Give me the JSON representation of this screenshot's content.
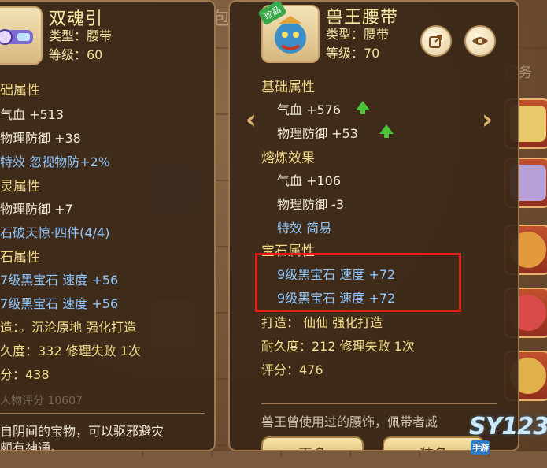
{
  "left_item": {
    "name": "双魂引",
    "type_line": "类型：腰带",
    "level_line": "等级：60",
    "sections": [
      {
        "title": "础属性"
      },
      {
        "title": "灵属性"
      },
      {
        "title": "石属性"
      }
    ],
    "base_lines": [
      "气血 +513",
      "物理防御 +38",
      "特效 忽视物防+2%"
    ],
    "spirit_lines": [
      "物理防御 +7",
      "石破天惊·四件(4/4)"
    ],
    "gem_lines": [
      "7级黑宝石  速度 +56",
      "7级黑宝石  速度 +56"
    ],
    "craft_line": "造：。沉沦原地   强化打造",
    "durability_line": "久度：332 修理失败 1次",
    "score_line": "分：438",
    "faded_line": "人物评分 10607",
    "desc_line1": "自阴间的宝物，可以驱邪避灾",
    "desc_line2": "颇有神通。"
  },
  "right_item": {
    "badge": "珍品",
    "name": "兽王腰带",
    "type_line": "类型：腰带",
    "level_line": "等级：70",
    "base_title": "基础属性",
    "base_lines": [
      "气血 +576",
      "物理防御 +53"
    ],
    "refine_title": "熔炼效果",
    "refine_lines": [
      "气血 +106",
      "物理防御 -3",
      "特效 简易"
    ],
    "gem_title": "宝石属性",
    "gem_lines": [
      "9级黑宝石  速度 +72",
      "9级黑宝石  速度 +72"
    ],
    "craft_line": "打造：  仙仙  强化打造",
    "durability_line": "耐久度：212 修理失败 1次",
    "score_line": "评分：476",
    "desc_line": "兽王曾使用过的腰饰，佩带者威",
    "button1": "更多",
    "button2": "装备"
  },
  "background_tabs": [
    "包",
    "任务"
  ],
  "icons": {
    "share": "share-icon",
    "eye": "eye-icon",
    "prev": "chevron-left-icon",
    "next": "chevron-right-icon",
    "up": "arrow-up-icon"
  },
  "watermark": {
    "text": "SY123",
    "tag": "手游"
  },
  "colors": {
    "highlight_box": "#e81b1b",
    "gem_text": "#8ec6ff",
    "up_arrow": "#4bc43c"
  }
}
